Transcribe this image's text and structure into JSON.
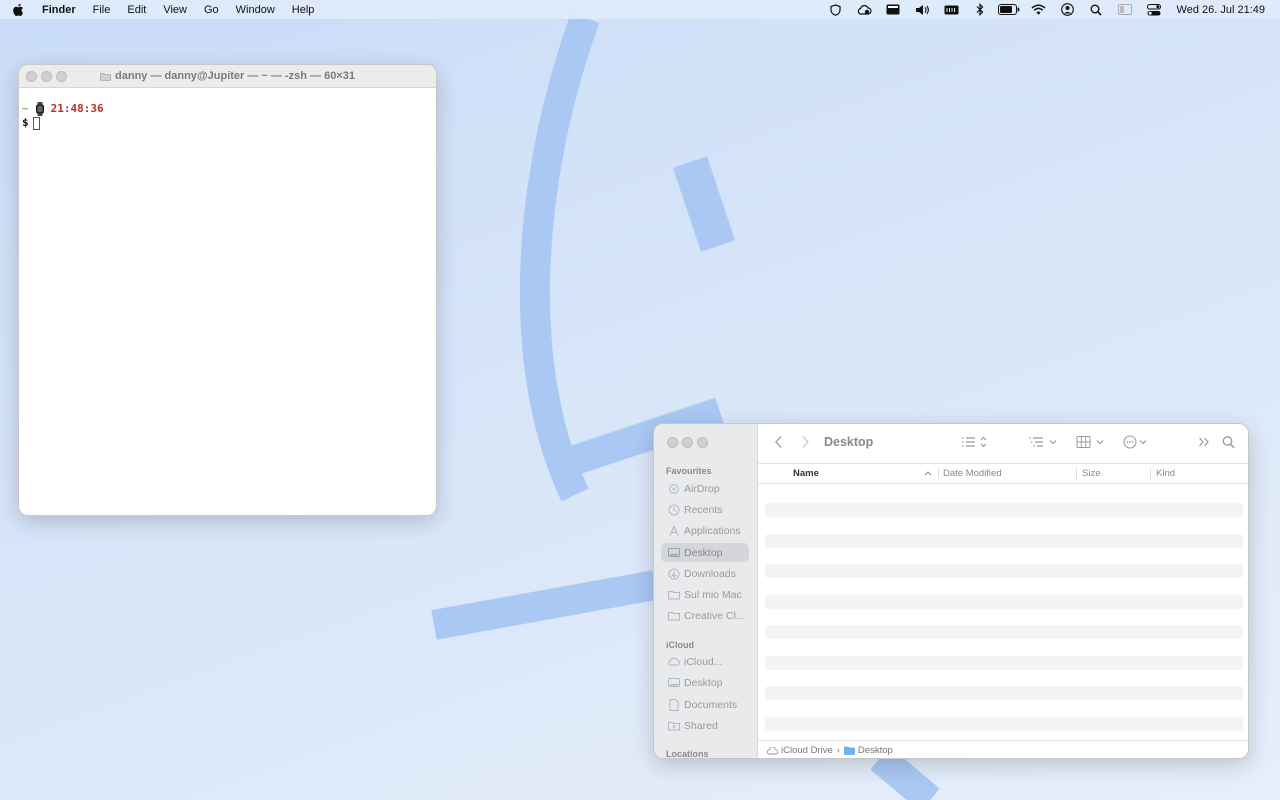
{
  "menubar": {
    "app_name": "Finder",
    "menus": [
      "File",
      "Edit",
      "View",
      "Go",
      "Window",
      "Help"
    ],
    "clock": "Wed 26. Jul  21:49",
    "status_icons": [
      "shield-icon",
      "cloud-sync-icon",
      "media-icon",
      "volume-icon",
      "keyboard-icon",
      "bluetooth-icon",
      "battery-icon",
      "wifi-icon",
      "user-icon",
      "spotlight-icon",
      "screen-mirror-icon",
      "control-center-icon"
    ]
  },
  "terminal": {
    "title": "danny — danny@Jupiter — ~ — -zsh — 60×31",
    "prompt_dir": "~",
    "prompt_time": "21:48:36",
    "prompt_symbol": "$"
  },
  "finder": {
    "current_folder": "Desktop",
    "sidebar": {
      "favourites_title": "Favourites",
      "favourites": [
        {
          "label": "AirDrop",
          "icon": "airdrop-icon"
        },
        {
          "label": "Recents",
          "icon": "clock-icon"
        },
        {
          "label": "Applications",
          "icon": "applications-icon"
        },
        {
          "label": "Desktop",
          "icon": "desktop-icon",
          "selected": true
        },
        {
          "label": "Downloads",
          "icon": "download-icon"
        },
        {
          "label": "Sul mio Mac",
          "icon": "folder-icon"
        },
        {
          "label": "Creative Cl...",
          "icon": "folder-icon"
        }
      ],
      "icloud_title": "iCloud",
      "icloud": [
        {
          "label": "iCloud...",
          "icon": "cloud-icon"
        },
        {
          "label": "Desktop",
          "icon": "desktop-icon"
        },
        {
          "label": "Documents",
          "icon": "document-icon"
        },
        {
          "label": "Shared",
          "icon": "shared-folder-icon"
        }
      ],
      "locations_title": "Locations"
    },
    "columns": {
      "name": "Name",
      "date_modified": "Date Modified",
      "size": "Size",
      "kind": "Kind"
    },
    "path": {
      "root": "iCloud Drive",
      "separator": "›",
      "current": "Desktop"
    }
  },
  "colors": {
    "accent": "#4a8fe7",
    "wallpaper_stroke": "#aac8f4",
    "terminal_time": "#b5322a"
  }
}
